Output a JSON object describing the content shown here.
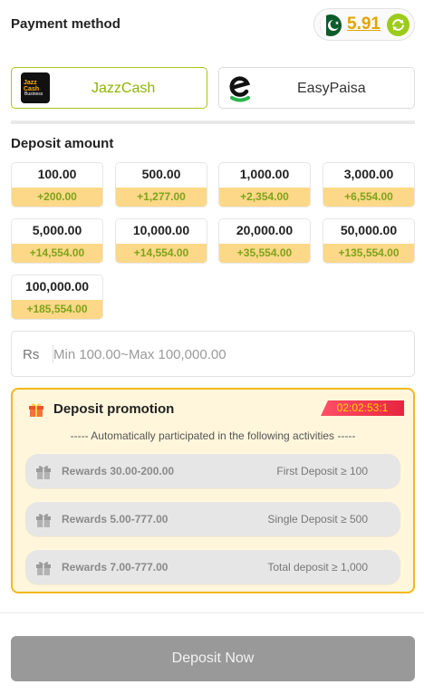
{
  "header": {
    "title": "Payment method",
    "balance": "5.91",
    "flag_icon": "pakistan-flag-icon",
    "refresh_icon": "refresh-icon"
  },
  "methods": [
    {
      "name": "JazzCash",
      "logo_text": "Jazz Cash",
      "logo_subtext": "Business",
      "selected": true,
      "accent": "#a6c71b"
    },
    {
      "name": "EasyPaisa",
      "selected": false,
      "accent": "#2bb34b"
    }
  ],
  "deposit": {
    "title": "Deposit amount",
    "amounts": [
      {
        "value": "100.00",
        "bonus": "+200.00"
      },
      {
        "value": "500.00",
        "bonus": "+1,277.00"
      },
      {
        "value": "1,000.00",
        "bonus": "+2,354.00"
      },
      {
        "value": "3,000.00",
        "bonus": "+6,554.00"
      },
      {
        "value": "5,000.00",
        "bonus": "+14,554.00"
      },
      {
        "value": "10,000.00",
        "bonus": "+14,554.00"
      },
      {
        "value": "20,000.00",
        "bonus": "+35,554.00"
      },
      {
        "value": "50,000.00",
        "bonus": "+135,554.00"
      },
      {
        "value": "100,000.00",
        "bonus": "+185,554.00"
      }
    ],
    "currency": "Rs",
    "placeholder": "Min 100.00~Max 100,000.00",
    "value": ""
  },
  "promotion": {
    "title": "Deposit promotion",
    "timer": "02:02:53:1",
    "subtitle": "----- Automatically participated in the following activities -----",
    "rewards": [
      {
        "label": "Rewards 30.00-200.00",
        "condition": "First Deposit ≥ 100"
      },
      {
        "label": "Rewards 5.00-777.00",
        "condition": "Single Deposit ≥ 500"
      },
      {
        "label": "Rewards 7.00-777.00",
        "condition": "Total deposit ≥ 1,000"
      }
    ]
  },
  "footer": {
    "button_label": "Deposit Now"
  },
  "colors": {
    "accent_gold": "#e2a400",
    "accent_green": "#9ccb1a",
    "bonus_bg": "#fcd888",
    "promo_border": "#f2b81c",
    "button_disabled": "#999999"
  }
}
